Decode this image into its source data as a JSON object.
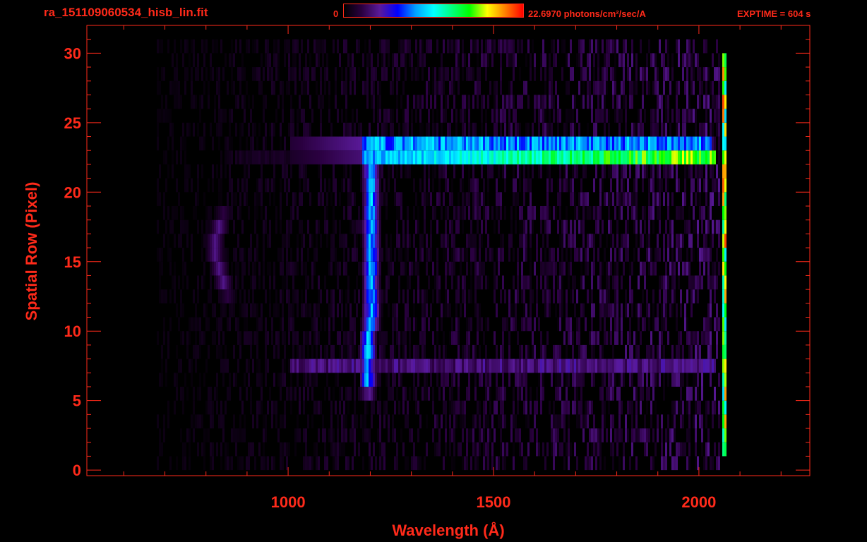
{
  "header": {
    "filename": "ra_151109060534_hisb_lin.fit",
    "colorbar_min": "0",
    "colorbar_max_label": "22.6970 photons/cm²/sec/A",
    "exptime": "EXPTIME = 604 s"
  },
  "colors": {
    "axis": "#ff2a1a",
    "background": "#000000",
    "colorbar_stops": [
      "#000000",
      "#2a0040",
      "#5a1a9a",
      "#0000ff",
      "#00a0ff",
      "#00ffff",
      "#00ff80",
      "#00ff00",
      "#ffff00",
      "#ff8000",
      "#ff0000"
    ]
  },
  "chart_data": {
    "type": "heatmap",
    "xlabel": "Wavelength (Å)",
    "ylabel": "Spatial Row (Pixel)",
    "xlim": [
      510,
      2270
    ],
    "ylim": [
      -0.4,
      32
    ],
    "xticks": [
      1000,
      1500,
      2000
    ],
    "yticks": [
      0,
      5,
      10,
      15,
      20,
      25,
      30
    ],
    "value_range": [
      0,
      22.697
    ],
    "value_unit": "photons/cm²/sec/A",
    "features": [
      {
        "name": "bright band upper",
        "rows": [
          22,
          24
        ],
        "wavelength_range": [
          1000,
          2030
        ],
        "peak_level": 0.45
      },
      {
        "name": "bright band lower",
        "rows": [
          22,
          23
        ],
        "wavelength_range": [
          1000,
          2040
        ],
        "peak_level": 0.75
      },
      {
        "name": "lyman-alpha line",
        "rows": [
          5,
          24
        ],
        "wavelength": 1216,
        "peak_level": 0.42
      },
      {
        "name": "834 arc",
        "rows": [
          12,
          19
        ],
        "wavelength_range": [
          800,
          870
        ],
        "peak_level": 0.18
      },
      {
        "name": "faint band",
        "rows": [
          7,
          8
        ],
        "wavelength_range": [
          1000,
          2040
        ],
        "peak_level": 0.2
      },
      {
        "name": "detector edge",
        "rows": [
          1,
          30
        ],
        "wavelength": 2060,
        "peak_level": 0.95
      }
    ]
  }
}
